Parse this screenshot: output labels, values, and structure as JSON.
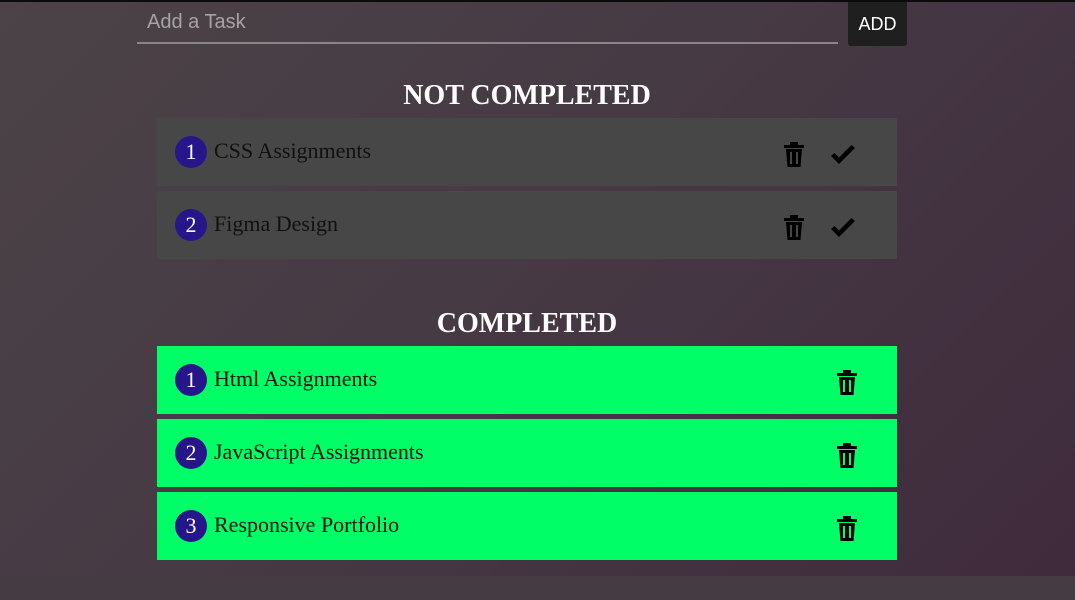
{
  "form": {
    "input_placeholder": "Add a Task",
    "input_value": "",
    "add_label": "ADD"
  },
  "not_completed": {
    "title": "NOT COMPLETED",
    "tasks": [
      {
        "number": "1",
        "text": "CSS Assignments"
      },
      {
        "number": "2",
        "text": "Figma Design"
      }
    ]
  },
  "completed": {
    "title": "COMPLETED",
    "tasks": [
      {
        "number": "1",
        "text": "Html Assignments"
      },
      {
        "number": "2",
        "text": "JavaScript Assignments"
      },
      {
        "number": "3",
        "text": "Responsive Portfolio"
      }
    ]
  },
  "icons": {
    "delete": "trash-icon",
    "complete": "check-icon"
  },
  "colors": {
    "pending_bg": "#474747",
    "completed_bg": "#00ff66",
    "number_badge": "#26168a",
    "add_button_bg": "#1f1f1f"
  }
}
